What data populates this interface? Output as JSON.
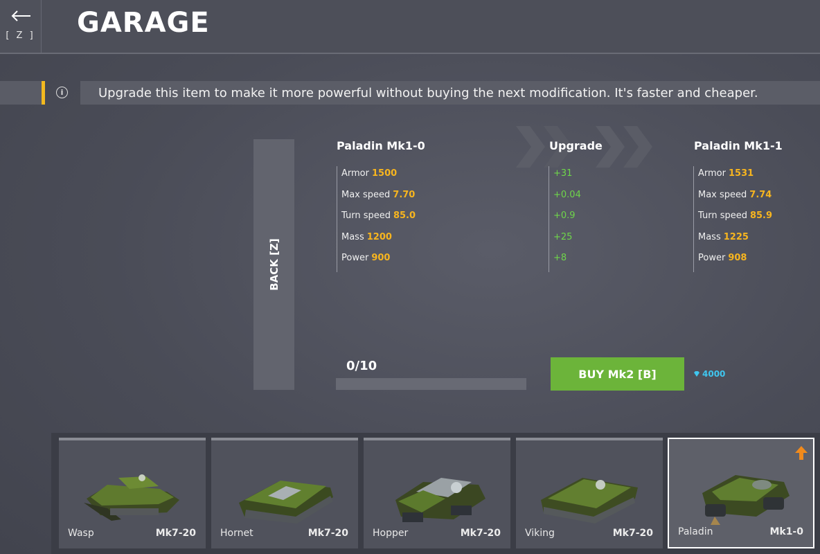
{
  "header": {
    "back_key": "[ Z ]",
    "title": "GARAGE"
  },
  "info": {
    "text": "Upgrade this item to make it more powerful without buying the next modification. It's faster and cheaper."
  },
  "side_back": {
    "label": "BACK [Z]"
  },
  "current": {
    "title": "Paladin Mk1-0",
    "stats": [
      {
        "label": "Armor",
        "value": "1500"
      },
      {
        "label": "Max speed",
        "value": "7.70"
      },
      {
        "label": "Turn speed",
        "value": "85.0"
      },
      {
        "label": "Mass",
        "value": "1200"
      },
      {
        "label": "Power",
        "value": "900"
      }
    ]
  },
  "upgrade": {
    "title": "Upgrade",
    "deltas": [
      "+31",
      "+0.04",
      "+0.9",
      "+25",
      "+8"
    ]
  },
  "next": {
    "title": "Paladin Mk1-1",
    "stats": [
      {
        "label": "Armor",
        "value": "1531"
      },
      {
        "label": "Max speed",
        "value": "7.74"
      },
      {
        "label": "Turn speed",
        "value": "85.9"
      },
      {
        "label": "Mass",
        "value": "1225"
      },
      {
        "label": "Power",
        "value": "908"
      }
    ]
  },
  "progress": {
    "label": "0/10",
    "fraction": 0.0
  },
  "buy": {
    "label": "BUY Mk2 [B]",
    "price": "4000"
  },
  "colors": {
    "accent_yellow": "#f3b91f",
    "stat_orange": "#f7b51f",
    "delta_green": "#6fd64a",
    "buy_green": "#6cb43a",
    "crystal_blue": "#3fc6ef"
  },
  "hulls": [
    {
      "name": "Wasp",
      "mod": "Mk7-20",
      "selected": false
    },
    {
      "name": "Hornet",
      "mod": "Mk7-20",
      "selected": false
    },
    {
      "name": "Hopper",
      "mod": "Mk7-20",
      "selected": false
    },
    {
      "name": "Viking",
      "mod": "Mk7-20",
      "selected": false
    },
    {
      "name": "Paladin",
      "mod": "Mk1-0",
      "selected": true
    }
  ]
}
